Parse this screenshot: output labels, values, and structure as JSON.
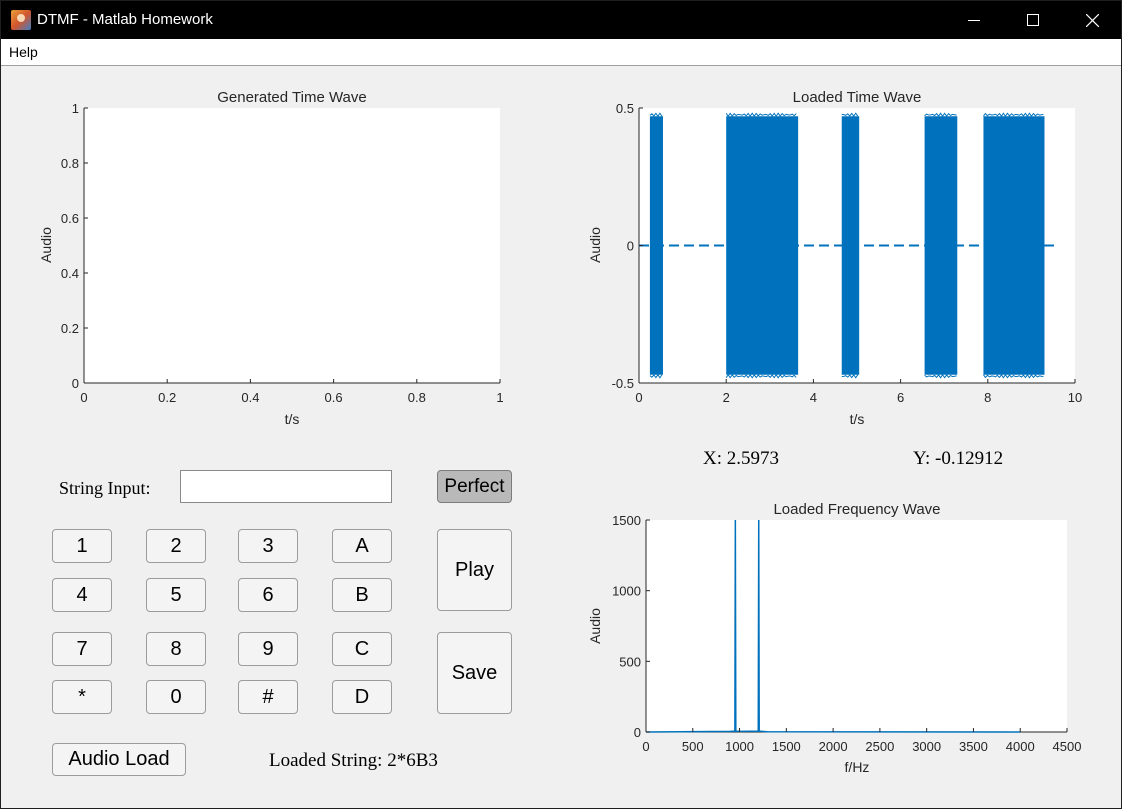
{
  "window": {
    "title": "DTMF - Matlab Homework"
  },
  "menu": {
    "help_label": "Help"
  },
  "generated_plot": {
    "title": "Generated Time Wave",
    "xlabel": "t/s",
    "ylabel": "Audio",
    "xticks": [
      "0",
      "0.2",
      "0.4",
      "0.6",
      "0.8",
      "1"
    ],
    "yticks": [
      "0",
      "0.2",
      "0.4",
      "0.6",
      "0.8",
      "1"
    ]
  },
  "loaded_time_plot": {
    "title": "Loaded Time Wave",
    "xlabel": "t/s",
    "ylabel": "Audio",
    "xticks": [
      "0",
      "2",
      "4",
      "6",
      "8",
      "10"
    ],
    "yticks": [
      "-0.5",
      "0",
      "0.5"
    ]
  },
  "cursor_readout": {
    "x_text": "X: 2.5973",
    "y_text": "Y: -0.12912"
  },
  "loaded_freq_plot": {
    "title": "Loaded Frequency Wave",
    "xlabel": "f/Hz",
    "ylabel": "Audio",
    "xticks": [
      "0",
      "500",
      "1000",
      "1500",
      "2000",
      "2500",
      "3000",
      "3500",
      "4000",
      "4500"
    ],
    "yticks": [
      "0",
      "500",
      "1000",
      "1500"
    ]
  },
  "input": {
    "label": "String Input:",
    "value": ""
  },
  "buttons": {
    "perfect": "Perfect",
    "play": "Play",
    "save": "Save",
    "audio_load": "Audio Load"
  },
  "keypad": [
    [
      "1",
      "2",
      "3",
      "A"
    ],
    [
      "4",
      "5",
      "6",
      "B"
    ],
    [
      "7",
      "8",
      "9",
      "C"
    ],
    [
      "*",
      "0",
      "#",
      "D"
    ]
  ],
  "loaded_string": {
    "text": "Loaded String: 2*6B3"
  },
  "colors": {
    "plot_line": "#0072bd",
    "dashed_zero": "#0072bd",
    "perfect_pressed": "#b9b9b9"
  },
  "chart_data": [
    {
      "type": "line",
      "title": "Generated Time Wave",
      "xlabel": "t/s",
      "ylabel": "Audio",
      "xlim": [
        0,
        1
      ],
      "ylim": [
        0,
        1
      ],
      "series": []
    },
    {
      "type": "line",
      "title": "Loaded Time Wave",
      "xlabel": "t/s",
      "ylabel": "Audio",
      "xlim": [
        0,
        10
      ],
      "ylim": [
        -0.5,
        0.5
      ],
      "bursts": [
        {
          "start": 0.25,
          "end": 0.55,
          "amplitude": 0.47
        },
        {
          "start": 2.0,
          "end": 3.65,
          "amplitude": 0.47
        },
        {
          "start": 4.65,
          "end": 5.05,
          "amplitude": 0.47
        },
        {
          "start": 6.55,
          "end": 7.3,
          "amplitude": 0.47
        },
        {
          "start": 7.9,
          "end": 9.3,
          "amplitude": 0.47
        }
      ],
      "reference_line": {
        "y": 0,
        "x_range": [
          0,
          9.6
        ],
        "style": "dashed"
      }
    },
    {
      "type": "line",
      "title": "Loaded Frequency Wave",
      "xlabel": "f/Hz",
      "ylabel": "Audio",
      "xlim": [
        0,
        4500
      ],
      "ylim": [
        0,
        1500
      ],
      "x": [
        0,
        900,
        950,
        955,
        960,
        1000,
        1200,
        1205,
        1210,
        1300,
        4000
      ],
      "y": [
        0,
        4,
        6,
        1520,
        6,
        4,
        6,
        1520,
        6,
        2,
        0
      ]
    }
  ]
}
